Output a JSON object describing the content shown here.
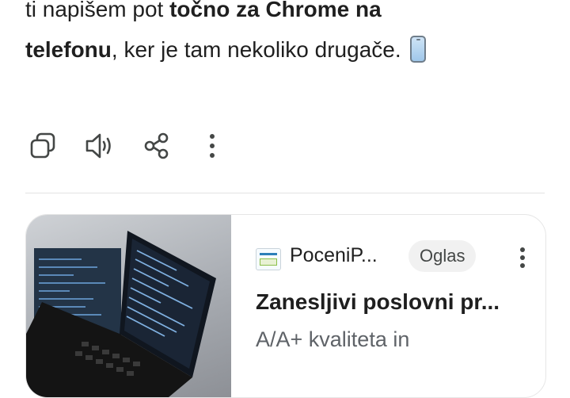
{
  "message": {
    "line1_start": "ti napišem pot ",
    "line1_bold": "točno za Chrome na",
    "line2_bold": "telefonu",
    "line2_rest": ", ker je tam nekoliko drugače."
  },
  "actions": {
    "copy_icon": "copy-icon",
    "read_aloud_icon": "speaker-icon",
    "share_icon": "share-icon",
    "more_icon": "more-vert-icon"
  },
  "ad": {
    "advertiser": "PoceniP...",
    "badge": "Oglas",
    "title": "Zanesljivi poslovni pr...",
    "description": "A/A+ kvaliteta in"
  },
  "colors": {
    "text": "#1f1f1f",
    "icon": "#444746",
    "secondary_text": "#5f6368",
    "badge_bg": "#f1f1f1"
  }
}
